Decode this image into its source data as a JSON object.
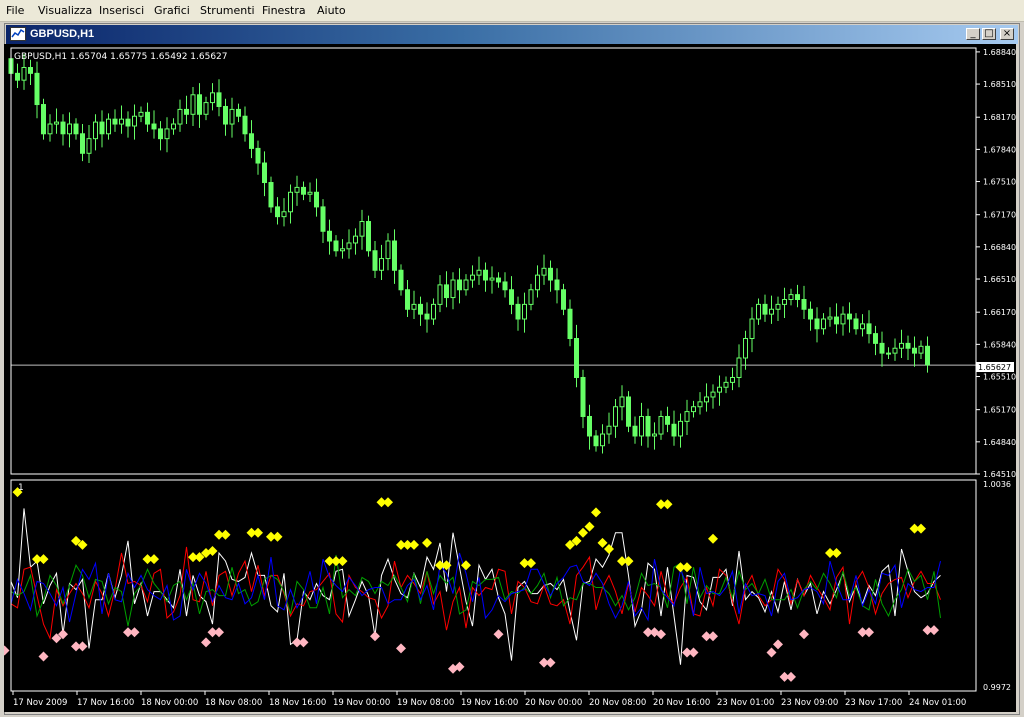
{
  "menu": [
    "File",
    "Visualizza",
    "Inserisci",
    "Grafici",
    "Strumenti",
    "Finestra",
    "Aiuto"
  ],
  "window": {
    "title": "GBPUSD,H1",
    "min_icon": "minimize-icon",
    "max_icon": "maximize-icon",
    "close_icon": "close-icon"
  },
  "colors": {
    "background": "#000000",
    "candle": "#66ff66",
    "white_line": "#ffffff",
    "red_line": "#ff0000",
    "green_line": "#00a000",
    "blue_line": "#0000ff",
    "diamond_high": "#ffff00",
    "diamond_low": "#ffb6c1",
    "title_start": "#0a246a"
  },
  "chart_data": [
    {
      "type": "candlestick",
      "title": "GBPUSD,H1",
      "ohlc_label": "1.65704 1.65775 1.65492 1.65627",
      "current_price_label": "1.65627",
      "ylim": [
        1.6451,
        1.6888
      ],
      "y_ticks": [
        "1.68840",
        "1.68510",
        "1.68170",
        "1.67840",
        "1.67510",
        "1.67170",
        "1.66840",
        "1.66510",
        "1.66170",
        "1.65840",
        "1.65510",
        "1.65170",
        "1.64840",
        "1.64510"
      ],
      "x_ticks": [
        "17 Nov 2009",
        "17 Nov 16:00",
        "18 Nov 00:00",
        "18 Nov 08:00",
        "18 Nov 16:00",
        "19 Nov 00:00",
        "19 Nov 08:00",
        "19 Nov 16:00",
        "20 Nov 00:00",
        "20 Nov 08:00",
        "20 Nov 16:00",
        "23 Nov 01:00",
        "23 Nov 09:00",
        "23 Nov 17:00",
        "24 Nov 01:00"
      ],
      "closes": [
        1.6862,
        1.6855,
        1.6868,
        1.6862,
        1.683,
        1.68,
        1.681,
        1.6812,
        1.68,
        1.681,
        1.68,
        1.678,
        1.6795,
        1.6812,
        1.68,
        1.6815,
        1.681,
        1.6815,
        1.6808,
        1.6818,
        1.6822,
        1.681,
        1.6805,
        1.6795,
        1.6805,
        1.681,
        1.6825,
        1.682,
        1.684,
        1.682,
        1.6832,
        1.6842,
        1.6828,
        1.681,
        1.6825,
        1.6818,
        1.68,
        1.6785,
        1.677,
        1.675,
        1.6725,
        1.6715,
        1.672,
        1.674,
        1.6745,
        1.6738,
        1.674,
        1.6725,
        1.67,
        1.669,
        1.668,
        1.6682,
        1.6688,
        1.6695,
        1.671,
        1.668,
        1.666,
        1.6672,
        1.669,
        1.666,
        1.664,
        1.662,
        1.6625,
        1.6615,
        1.661,
        1.6625,
        1.6645,
        1.6632,
        1.665,
        1.664,
        1.665,
        1.6655,
        1.666,
        1.665,
        1.6652,
        1.6648,
        1.664,
        1.6625,
        1.661,
        1.6625,
        1.664,
        1.6655,
        1.6662,
        1.665,
        1.664,
        1.662,
        1.659,
        1.655,
        1.651,
        1.649,
        1.648,
        1.6492,
        1.65,
        1.652,
        1.653,
        1.65,
        1.649,
        1.651,
        1.649,
        1.6492,
        1.651,
        1.6502,
        1.649,
        1.6505,
        1.6515,
        1.652,
        1.6525,
        1.653,
        1.6535,
        1.654,
        1.6545,
        1.655,
        1.657,
        1.659,
        1.661,
        1.6625,
        1.6615,
        1.662,
        1.6625,
        1.663,
        1.6635,
        1.663,
        1.662,
        1.661,
        1.66,
        1.661,
        1.6612,
        1.6605,
        1.6615,
        1.661,
        1.66,
        1.6605,
        1.6595,
        1.6585,
        1.6575,
        1.6575,
        1.658,
        1.6585,
        1.658,
        1.6575,
        1.6582,
        1.6563
      ]
    },
    {
      "type": "line",
      "ylim": [
        0.9972,
        1.0036
      ],
      "y_ticks": [
        "1.0036",
        "0.9972"
      ],
      "corner_label": "1",
      "series": [
        {
          "color": "#ffffff",
          "values": [
            0.52,
            0.44,
            0.88,
            0.59,
            0.62,
            0.41,
            0.5,
            0.56,
            0.26,
            0.51,
            0.48,
            0.53,
            0.19,
            0.43,
            0.43,
            0.56,
            0.44,
            0.55,
            0.72,
            0.41,
            0.51,
            0.35,
            0.47,
            0.47,
            0.43,
            0.39,
            0.58,
            0.35,
            0.55,
            0.45,
            0.42,
            0.31,
            0.66,
            0.62,
            0.53,
            0.52,
            0.54,
            0.66,
            0.55,
            0.55,
            0.4,
            0.37,
            0.56,
            0.21,
            0.23,
            0.47,
            0.43,
            0.51,
            0.45,
            0.43,
            0.57,
            0.58,
            0.35,
            0.43,
            0.52,
            0.45,
            0.25,
            0.55,
            0.63,
            0.53,
            0.46,
            0.44,
            0.56,
            0.49,
            0.64,
            0.58,
            0.71,
            0.47,
            0.76,
            0.59,
            0.42,
            0.3,
            0.6,
            0.53,
            0.58,
            0.44,
            0.36,
            0.13,
            0.49,
            0.52,
            0.46,
            0.46,
            0.5,
            0.51,
            0.48,
            0.53,
            0.37,
            0.23,
            0.51,
            0.52,
            0.63,
            0.59,
            0.65,
            0.76,
            0.76,
            0.55,
            0.3,
            0.38,
            0.61,
            0.58,
            0.35,
            0.59,
            0.35,
            0.11,
            0.55,
            0.54,
            0.42,
            0.38,
            0.54,
            0.54,
            0.58,
            0.4,
            0.67,
            0.43,
            0.47,
            0.44,
            0.37,
            0.47,
            0.37,
            0.52,
            0.38,
            0.53,
            0.45,
            0.51,
            0.36,
            0.47,
            0.41,
            0.48,
            0.56,
            0.42,
            0.5,
            0.41,
            0.5,
            0.45,
            0.57,
            0.6,
            0.35,
            0.68,
            0.57,
            0.47,
            0.44,
            0.46,
            0.52,
            0.55
          ]
        },
        {
          "color": "#ff0000",
          "values": [
            0.41,
            0.39,
            0.58,
            0.59,
            0.45,
            0.31,
            0.24,
            0.48,
            0.4,
            0.46,
            0.51,
            0.46,
            0.39,
            0.52,
            0.46,
            0.35,
            0.48,
            0.66,
            0.51,
            0.52,
            0.5,
            0.42,
            0.56,
            0.58,
            0.34,
            0.37,
            0.45,
            0.69,
            0.43,
            0.42,
            0.57,
            0.4,
            0.55,
            0.57,
            0.45,
            0.56,
            0.62,
            0.47,
            0.6,
            0.45,
            0.55,
            0.55,
            0.46,
            0.35,
            0.41,
            0.4,
            0.47,
            0.48,
            0.52,
            0.56,
            0.36,
            0.32,
            0.55,
            0.49,
            0.47,
            0.44,
            0.43,
            0.34,
            0.4,
            0.62,
            0.49,
            0.55,
            0.51,
            0.46,
            0.57,
            0.41,
            0.47,
            0.28,
            0.42,
            0.49,
            0.29,
            0.49,
            0.45,
            0.49,
            0.48,
            0.58,
            0.57,
            0.36,
            0.52,
            0.49,
            0.42,
            0.41,
            0.5,
            0.41,
            0.4,
            0.43,
            0.31,
            0.55,
            0.59,
            0.64,
            0.38,
            0.49,
            0.55,
            0.47,
            0.36,
            0.51,
            0.37,
            0.49,
            0.45,
            0.4,
            0.57,
            0.45,
            0.41,
            0.49,
            0.54,
            0.36,
            0.35,
            0.49,
            0.4,
            0.58,
            0.55,
            0.42,
            0.31,
            0.49,
            0.55,
            0.45,
            0.4,
            0.43,
            0.58,
            0.53,
            0.41,
            0.53,
            0.45,
            0.55,
            0.49,
            0.44,
            0.38,
            0.54,
            0.59,
            0.31,
            0.52,
            0.57,
            0.49,
            0.36,
            0.46,
            0.51,
            0.53,
            0.54,
            0.44,
            0.52,
            0.57,
            0.51,
            0.51,
            0.43
          ]
        },
        {
          "color": "#00a000",
          "values": [
            0.47,
            0.45,
            0.47,
            0.55,
            0.35,
            0.43,
            0.55,
            0.5,
            0.41,
            0.5,
            0.6,
            0.55,
            0.44,
            0.53,
            0.52,
            0.41,
            0.49,
            0.47,
            0.3,
            0.46,
            0.5,
            0.58,
            0.51,
            0.47,
            0.42,
            0.5,
            0.52,
            0.43,
            0.51,
            0.36,
            0.47,
            0.48,
            0.45,
            0.45,
            0.59,
            0.46,
            0.48,
            0.4,
            0.42,
            0.53,
            0.55,
            0.53,
            0.47,
            0.36,
            0.52,
            0.48,
            0.39,
            0.39,
            0.49,
            0.36,
            0.65,
            0.44,
            0.48,
            0.45,
            0.54,
            0.52,
            0.46,
            0.52,
            0.5,
            0.55,
            0.49,
            0.42,
            0.56,
            0.41,
            0.57,
            0.46,
            0.55,
            0.51,
            0.54,
            0.36,
            0.38,
            0.52,
            0.5,
            0.53,
            0.53,
            0.54,
            0.43,
            0.47,
            0.46,
            0.49,
            0.46,
            0.5,
            0.56,
            0.44,
            0.54,
            0.4,
            0.44,
            0.43,
            0.51,
            0.51,
            0.49,
            0.49,
            0.46,
            0.4,
            0.45,
            0.38,
            0.44,
            0.56,
            0.5,
            0.51,
            0.49,
            0.39,
            0.59,
            0.61,
            0.41,
            0.59,
            0.44,
            0.5,
            0.46,
            0.46,
            0.54,
            0.44,
            0.57,
            0.48,
            0.51,
            0.46,
            0.53,
            0.43,
            0.43,
            0.43,
            0.48,
            0.39,
            0.48,
            0.52,
            0.48,
            0.56,
            0.51,
            0.44,
            0.57,
            0.45,
            0.49,
            0.4,
            0.38,
            0.53,
            0.41,
            0.35,
            0.43,
            0.48,
            0.58,
            0.52,
            0.55,
            0.43,
            0.57,
            0.34
          ]
        },
        {
          "color": "#0000ff",
          "values": [
            0.41,
            0.53,
            0.46,
            0.38,
            0.52,
            0.51,
            0.46,
            0.4,
            0.49,
            0.32,
            0.46,
            0.58,
            0.53,
            0.61,
            0.36,
            0.56,
            0.43,
            0.42,
            0.56,
            0.49,
            0.55,
            0.48,
            0.45,
            0.43,
            0.5,
            0.33,
            0.35,
            0.58,
            0.48,
            0.56,
            0.51,
            0.42,
            0.5,
            0.44,
            0.43,
            0.51,
            0.41,
            0.44,
            0.55,
            0.43,
            0.64,
            0.4,
            0.38,
            0.48,
            0.39,
            0.45,
            0.57,
            0.41,
            0.63,
            0.54,
            0.5,
            0.47,
            0.54,
            0.5,
            0.45,
            0.48,
            0.49,
            0.49,
            0.41,
            0.43,
            0.43,
            0.5,
            0.53,
            0.43,
            0.5,
            0.38,
            0.6,
            0.56,
            0.46,
            0.66,
            0.56,
            0.42,
            0.54,
            0.34,
            0.38,
            0.45,
            0.42,
            0.46,
            0.47,
            0.48,
            0.58,
            0.58,
            0.51,
            0.45,
            0.51,
            0.54,
            0.59,
            0.6,
            0.52,
            0.5,
            0.56,
            0.51,
            0.41,
            0.34,
            0.4,
            0.52,
            0.35,
            0.39,
            0.33,
            0.63,
            0.48,
            0.44,
            0.4,
            0.58,
            0.5,
            0.35,
            0.59,
            0.46,
            0.47,
            0.45,
            0.49,
            0.57,
            0.36,
            0.51,
            0.45,
            0.46,
            0.45,
            0.35,
            0.52,
            0.56,
            0.43,
            0.44,
            0.48,
            0.49,
            0.47,
            0.41,
            0.62,
            0.51,
            0.43,
            0.43,
            0.55,
            0.4,
            0.48,
            0.41,
            0.56,
            0.55,
            0.6,
            0.39,
            0.51,
            0.48,
            0.47,
            0.49,
            0.49,
            0.62
          ]
        }
      ],
      "markers_high": [
        [
          1,
          0.96
        ],
        [
          4,
          0.63
        ],
        [
          5,
          0.63
        ],
        [
          10,
          0.72
        ],
        [
          11,
          0.7
        ],
        [
          21,
          0.63
        ],
        [
          22,
          0.63
        ],
        [
          28,
          0.64
        ],
        [
          29,
          0.64
        ],
        [
          30,
          0.66
        ],
        [
          31,
          0.67
        ],
        [
          32,
          0.75
        ],
        [
          33,
          0.75
        ],
        [
          37,
          0.76
        ],
        [
          38,
          0.76
        ],
        [
          40,
          0.74
        ],
        [
          41,
          0.74
        ],
        [
          49,
          0.62
        ],
        [
          50,
          0.62
        ],
        [
          51,
          0.62
        ],
        [
          57,
          0.91
        ],
        [
          58,
          0.91
        ],
        [
          60,
          0.7
        ],
        [
          61,
          0.7
        ],
        [
          62,
          0.7
        ],
        [
          64,
          0.71
        ],
        [
          66,
          0.6
        ],
        [
          67,
          0.6
        ],
        [
          70,
          0.6
        ],
        [
          79,
          0.61
        ],
        [
          80,
          0.61
        ],
        [
          86,
          0.7
        ],
        [
          87,
          0.72
        ],
        [
          88,
          0.76
        ],
        [
          89,
          0.79
        ],
        [
          90,
          0.86
        ],
        [
          91,
          0.71
        ],
        [
          92,
          0.68
        ],
        [
          94,
          0.62
        ],
        [
          95,
          0.62
        ],
        [
          100,
          0.9
        ],
        [
          101,
          0.9
        ],
        [
          103,
          0.59
        ],
        [
          104,
          0.59
        ],
        [
          108,
          0.73
        ],
        [
          126,
          0.66
        ],
        [
          127,
          0.66
        ],
        [
          139,
          0.78
        ],
        [
          140,
          0.78
        ]
      ],
      "markers_low": [
        [
          -1,
          0.18
        ],
        [
          5,
          0.15
        ],
        [
          7,
          0.24
        ],
        [
          8,
          0.26
        ],
        [
          10,
          0.2
        ],
        [
          11,
          0.2
        ],
        [
          18,
          0.27
        ],
        [
          19,
          0.27
        ],
        [
          30,
          0.22
        ],
        [
          31,
          0.27
        ],
        [
          32,
          0.27
        ],
        [
          44,
          0.22
        ],
        [
          45,
          0.22
        ],
        [
          56,
          0.25
        ],
        [
          60,
          0.19
        ],
        [
          68,
          0.09
        ],
        [
          69,
          0.1
        ],
        [
          75,
          0.26
        ],
        [
          82,
          0.12
        ],
        [
          83,
          0.12
        ],
        [
          98,
          0.27
        ],
        [
          99,
          0.27
        ],
        [
          100,
          0.26
        ],
        [
          104,
          0.17
        ],
        [
          105,
          0.17
        ],
        [
          107,
          0.25
        ],
        [
          108,
          0.25
        ],
        [
          117,
          0.17
        ],
        [
          118,
          0.21
        ],
        [
          119,
          0.05
        ],
        [
          120,
          0.05
        ],
        [
          122,
          0.26
        ],
        [
          131,
          0.27
        ],
        [
          132,
          0.27
        ],
        [
          141,
          0.28
        ],
        [
          142,
          0.28
        ]
      ],
      "x_ticks": [
        "17 Nov 2009",
        "17 Nov 16:00",
        "18 Nov 00:00",
        "18 Nov 08:00",
        "18 Nov 16:00",
        "19 Nov 00:00",
        "19 Nov 08:00",
        "19 Nov 16:00",
        "20 Nov 00:00",
        "20 Nov 08:00",
        "20 Nov 16:00",
        "23 Nov 01:00",
        "23 Nov 09:00",
        "23 Nov 17:00",
        "24 Nov 01:00"
      ]
    }
  ]
}
